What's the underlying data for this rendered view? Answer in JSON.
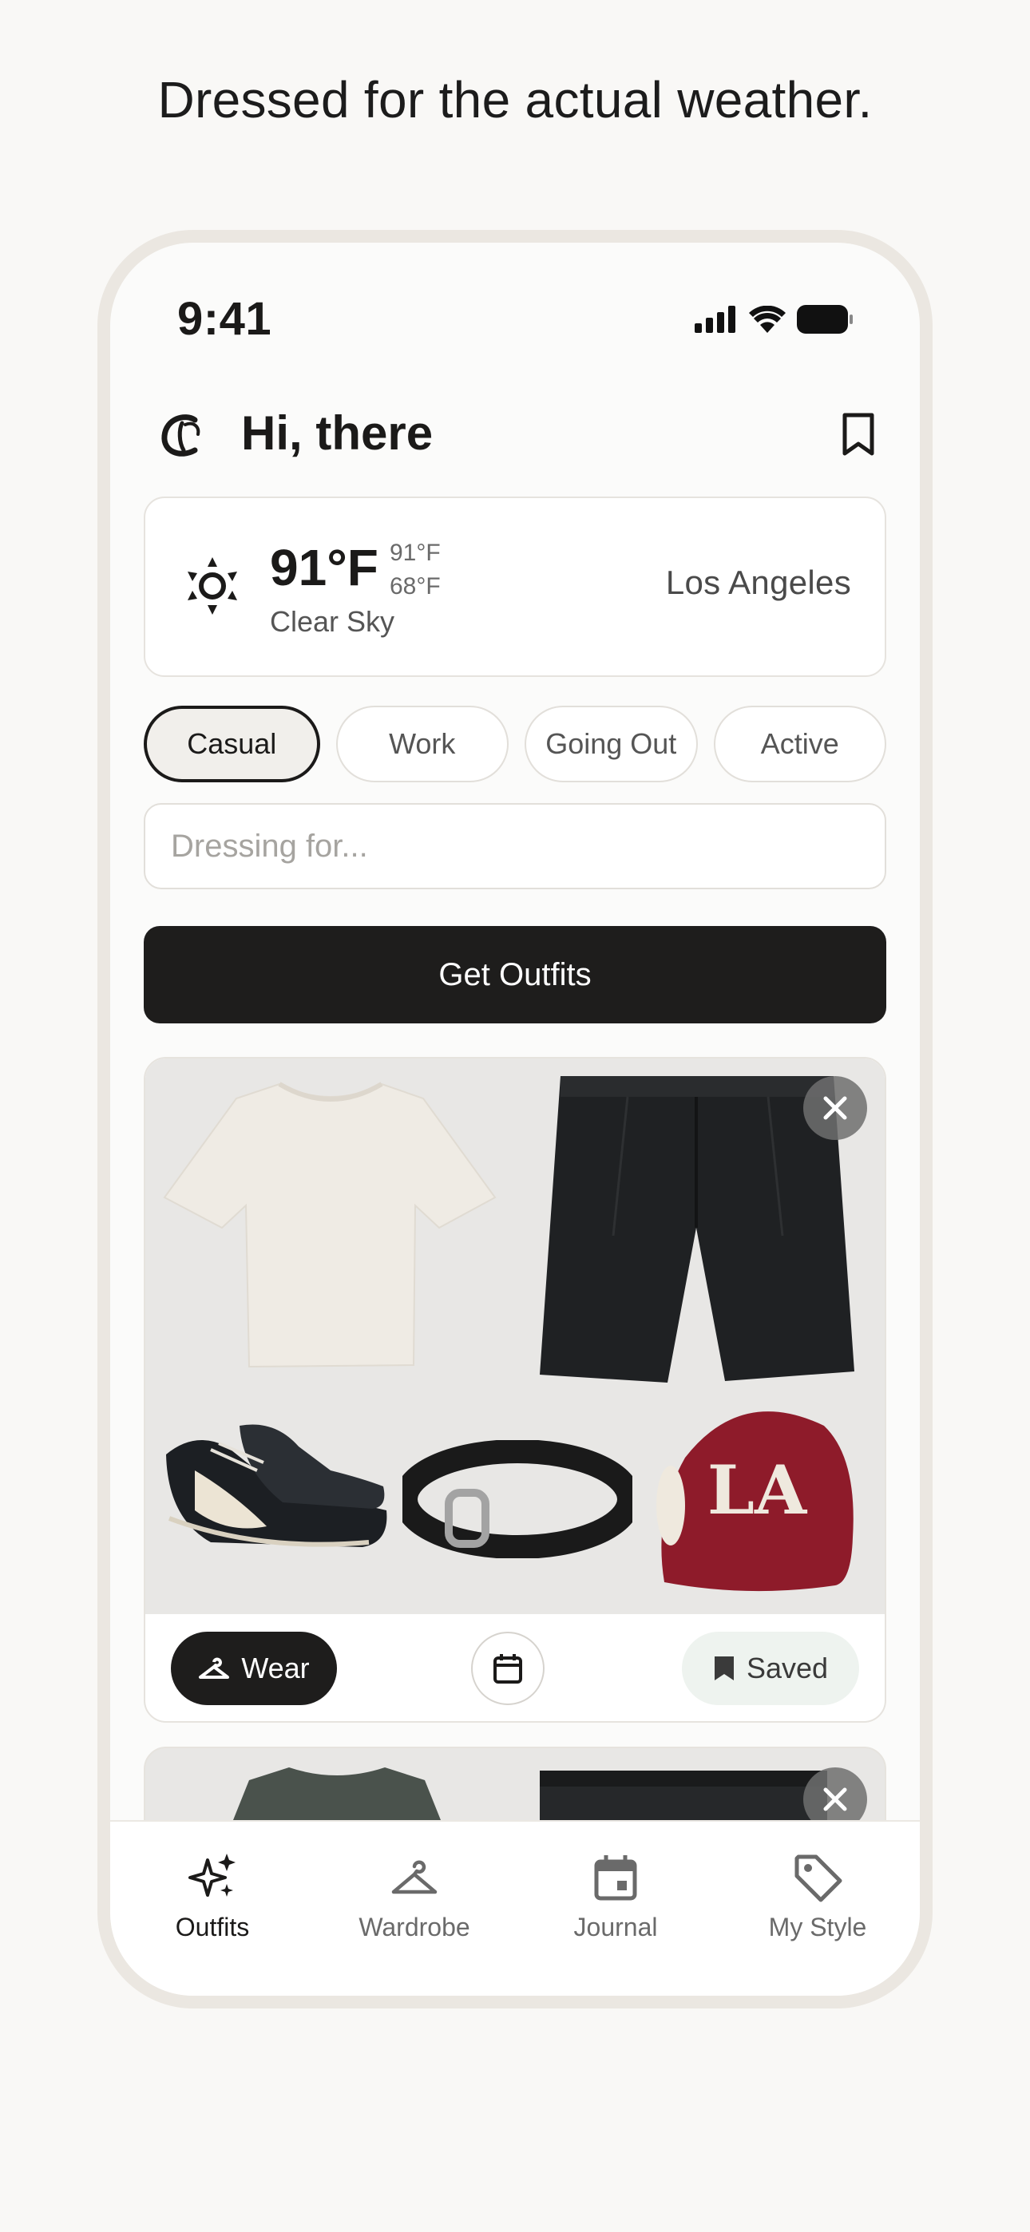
{
  "headline": "Dressed for the actual weather.",
  "status": {
    "time": "9:41"
  },
  "header": {
    "greeting": "Hi, there",
    "logo_glyph": "ℭ"
  },
  "weather": {
    "temp": "91°F",
    "high": "91°F",
    "low": "68°F",
    "condition": "Clear Sky",
    "city": "Los Angeles",
    "icon": "sun-icon"
  },
  "chips": [
    {
      "label": "Casual",
      "active": true
    },
    {
      "label": "Work",
      "active": false
    },
    {
      "label": "Going Out",
      "active": false
    },
    {
      "label": "Active",
      "active": false
    }
  ],
  "search": {
    "placeholder": "Dressing for...",
    "value": ""
  },
  "cta": {
    "label": "Get Outfits"
  },
  "outfit": {
    "items": [
      "t-shirt",
      "shorts",
      "sneakers",
      "belt",
      "cap"
    ],
    "cap_logo": "LA",
    "actions": {
      "wear": "Wear",
      "saved": "Saved"
    }
  },
  "tabs": [
    {
      "label": "Outfits",
      "icon": "sparkles-icon",
      "active": true
    },
    {
      "label": "Wardrobe",
      "icon": "hanger-icon",
      "active": false
    },
    {
      "label": "Journal",
      "icon": "calendar-icon",
      "active": false
    },
    {
      "label": "My Style",
      "icon": "tag-icon",
      "active": false
    }
  ],
  "colors": {
    "accent": "#1e1d1c",
    "background": "#f9f8f6",
    "saved_bg": "#eef3ef",
    "cap": "#8e1b2a"
  }
}
